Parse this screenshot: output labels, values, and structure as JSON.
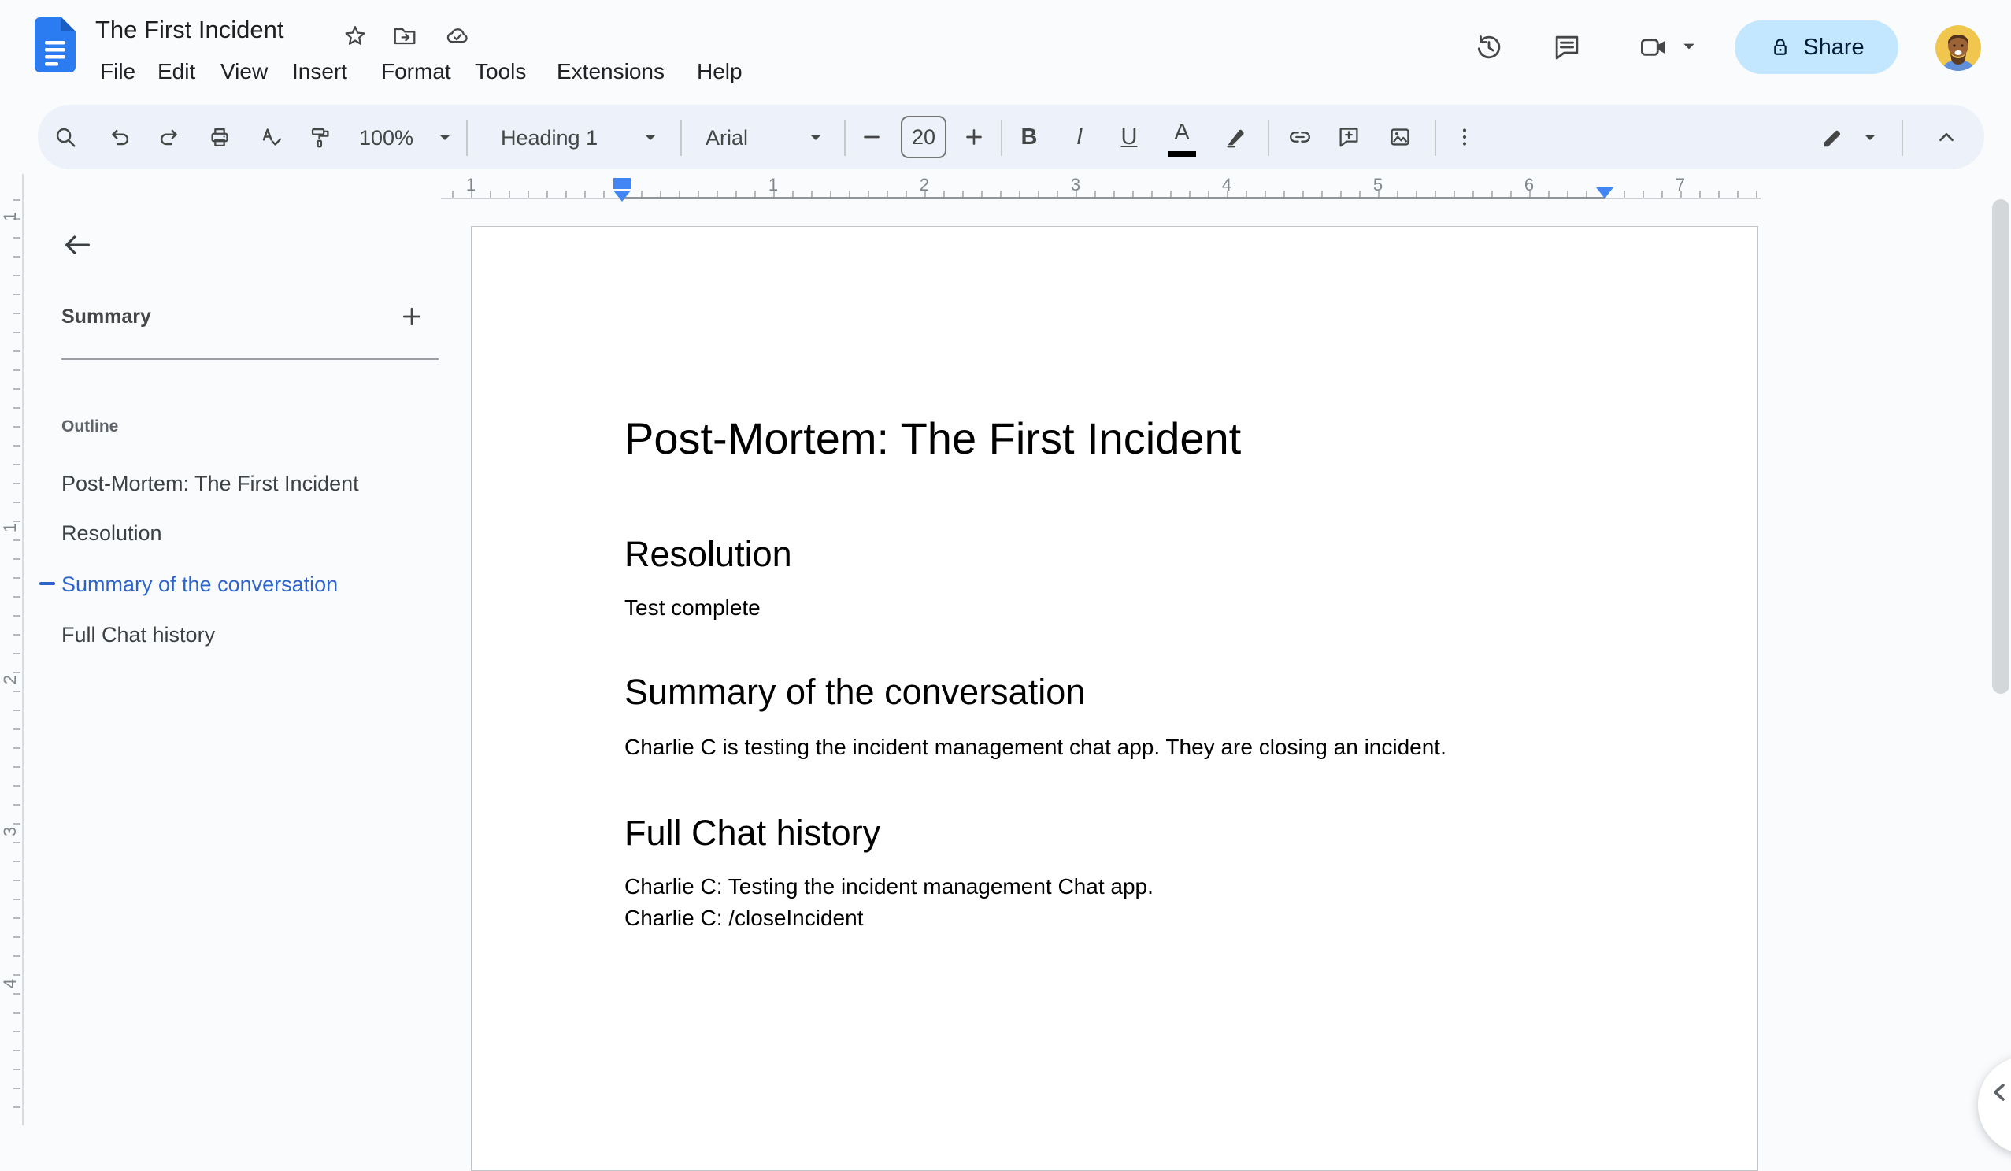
{
  "header": {
    "doc_title": "The First Incident",
    "menus": [
      "File",
      "Edit",
      "View",
      "Insert",
      "Format",
      "Tools",
      "Extensions",
      "Help"
    ],
    "share_label": "Share"
  },
  "toolbar": {
    "zoom": "100%",
    "paragraph_style": "Heading 1",
    "font_family": "Arial",
    "font_size": "20",
    "bold": "B",
    "italic": "I",
    "underline": "U",
    "text_color": "A"
  },
  "ruler": {
    "horizontal_numbers": [
      "1",
      "1",
      "2",
      "3",
      "4",
      "5",
      "6",
      "7"
    ],
    "vertical_numbers": [
      "1",
      "1",
      "2",
      "3",
      "4"
    ]
  },
  "outline_panel": {
    "summary_label": "Summary",
    "outline_label": "Outline",
    "items": [
      {
        "label": "Post-Mortem: The First Incident",
        "active": false
      },
      {
        "label": "Resolution",
        "active": false
      },
      {
        "label": "Summary of the conversation",
        "active": true
      },
      {
        "label": "Full Chat history",
        "active": false
      }
    ]
  },
  "document": {
    "title": "Post-Mortem: The First Incident",
    "sections": [
      {
        "heading": "Resolution",
        "paragraphs": [
          "Test complete"
        ]
      },
      {
        "heading": "Summary of the conversation",
        "paragraphs": [
          "Charlie C is testing the incident management chat app. They are closing an incident."
        ]
      },
      {
        "heading": "Full Chat history",
        "paragraphs": [
          "Charlie C: Testing the incident management Chat app.",
          "Charlie C: /closeIncident"
        ]
      }
    ]
  },
  "colors": {
    "accent_blue": "#2e64c8",
    "marker_blue": "#4285f4",
    "share_bg": "#c2e7ff",
    "share_text": "#001d35",
    "toolbar_bg": "#edf2fa",
    "canvas_bg": "#f9fbfd",
    "icon_gray": "#444746"
  }
}
